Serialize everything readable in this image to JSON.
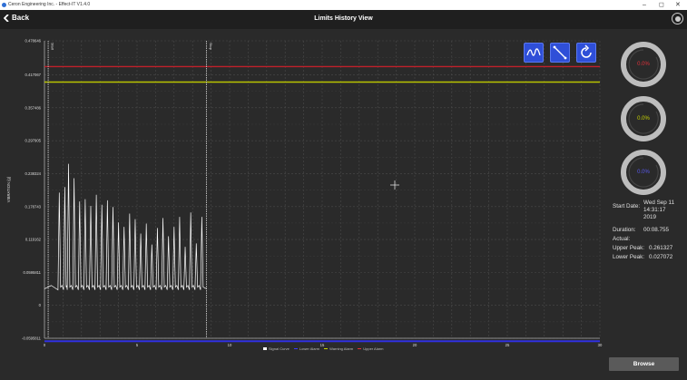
{
  "window": {
    "title": "Ceron Engineering Inc. - Effect-IT V1.4.0",
    "minimize": "–",
    "maximize": "◻",
    "close": "✕"
  },
  "header": {
    "back_label": "Back",
    "title": "Limits History View"
  },
  "toolbar": {
    "wave_icon": "wave-icon",
    "line_icon": "diagonal-line-icon",
    "refresh_icon": "refresh-icon"
  },
  "gauges": [
    {
      "value": "0.0%",
      "color": "#e0303a",
      "fraction": 0.0
    },
    {
      "value": "0.0%",
      "color": "#c8d400",
      "fraction": 0.0
    },
    {
      "value": "0.0%",
      "color": "#5a5af0",
      "fraction": 0.0
    }
  ],
  "info": {
    "start_date_label": "Start Date:",
    "start_date_line1": "Wed Sep 11",
    "start_date_line2": "14:31:17",
    "start_date_line3": "2019",
    "duration_label": "Duration:",
    "duration_value": "00:08.755",
    "actual_label": "Actual:",
    "upper_peak_label": "Upper Peak:",
    "upper_peak_value": "0.261327",
    "lower_peak_label": "Lower Peak:",
    "lower_peak_value": "0.027072"
  },
  "browse_label": "Browse",
  "chart_data": {
    "type": "line",
    "ylabel": "VIBRATION (g)",
    "xlim": [
      0,
      30
    ],
    "ylim": [
      -0.0595811,
      0.478646
    ],
    "y_ticks": [
      "0.478646",
      "0.417067",
      "0.357486",
      "0.297905",
      "0.238324",
      "0.178743",
      "0.119162",
      "0.0595811",
      "0",
      "-0.0595811"
    ],
    "x_ticks": [
      "0",
      "5",
      "10",
      "15",
      "20",
      "25",
      "30"
    ],
    "upper_alarm": 0.432,
    "warning_alarm": 0.404,
    "lower_alarm": -0.065,
    "markers": [
      {
        "label": "Start",
        "x": 0.2
      },
      {
        "label": "Stop",
        "x": 8.755
      }
    ],
    "signal_baseline": 0.03,
    "signal_peaks": [
      [
        0.8,
        0.204
      ],
      [
        1.1,
        0.214
      ],
      [
        1.3,
        0.256
      ],
      [
        1.6,
        0.23
      ],
      [
        1.9,
        0.188
      ],
      [
        2.2,
        0.192
      ],
      [
        2.5,
        0.18
      ],
      [
        2.8,
        0.2
      ],
      [
        3.1,
        0.182
      ],
      [
        3.4,
        0.19
      ],
      [
        3.7,
        0.178
      ],
      [
        4.0,
        0.15
      ],
      [
        4.3,
        0.142
      ],
      [
        4.6,
        0.166
      ],
      [
        4.9,
        0.156
      ],
      [
        5.2,
        0.13
      ],
      [
        5.5,
        0.148
      ],
      [
        5.8,
        0.11
      ],
      [
        6.1,
        0.14
      ],
      [
        6.4,
        0.158
      ],
      [
        6.7,
        0.125
      ],
      [
        7.0,
        0.142
      ],
      [
        7.3,
        0.16
      ],
      [
        7.6,
        0.106
      ],
      [
        7.9,
        0.168
      ],
      [
        8.2,
        0.112
      ],
      [
        8.5,
        0.16
      ]
    ],
    "legend": [
      {
        "name": "Signal Curve",
        "color": "#ffffff"
      },
      {
        "name": "Lower Alarm",
        "color": "#3a3aff"
      },
      {
        "name": "Warning Alarm",
        "color": "#c8d400"
      },
      {
        "name": "Upper Alarm",
        "color": "#e0303a"
      }
    ]
  }
}
